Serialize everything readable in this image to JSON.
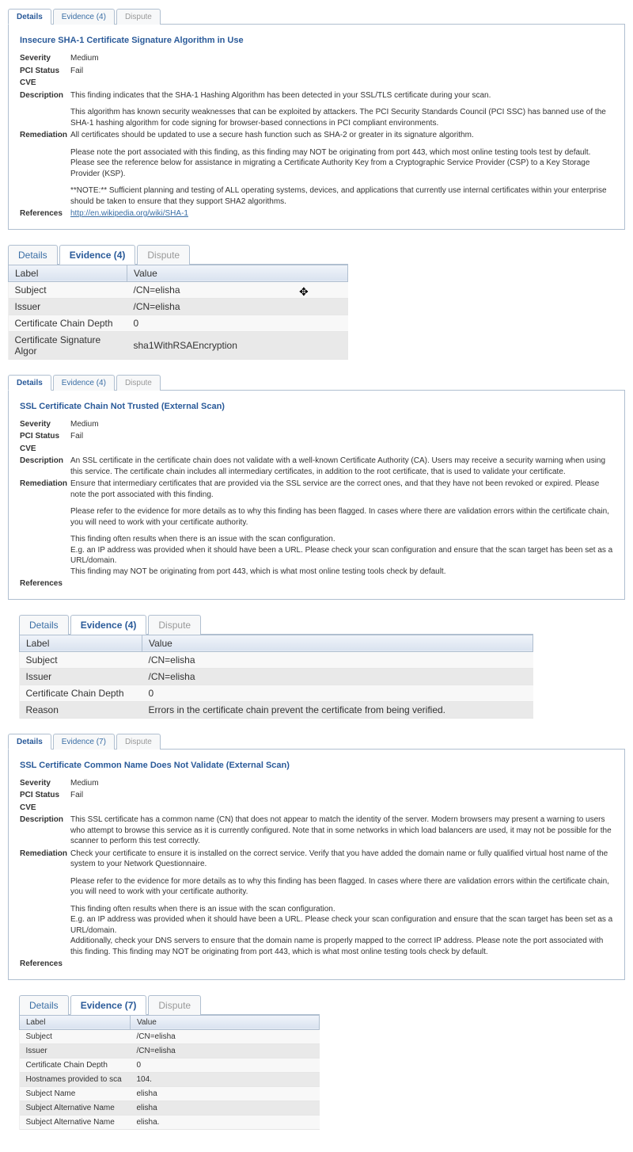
{
  "labels": {
    "details": "Details",
    "dispute": "Dispute",
    "severity": "Severity",
    "pci_status": "PCI Status",
    "cve": "CVE",
    "description": "Description",
    "remediation": "Remediation",
    "references": "References",
    "label_col": "Label",
    "value_col": "Value"
  },
  "finding1": {
    "evidence_tab": "Evidence (4)",
    "title": "Insecure SHA-1 Certificate Signature Algorithm in Use",
    "severity": "Medium",
    "pci_status": "Fail",
    "cve": "",
    "description_p1": "This finding indicates that the SHA-1 Hashing Algorithm has been detected in your SSL/TLS certificate during your scan.",
    "description_p2": "This algorithm has known security weaknesses that can be exploited by attackers. The PCI Security Standards Council (PCI SSC) has banned use of the SHA-1 hashing algorithm for code signing for browser-based connections in PCI compliant environments.",
    "remediation_p1": "All certificates should be updated to use a secure hash function such as SHA-2 or greater in its signature algorithm.",
    "remediation_p2": "Please note the port associated with this finding, as this finding may NOT be originating from port 443, which most online testing tools test by default. Please see the reference below for assistance in migrating a Certificate Authority Key from a Cryptographic Service Provider (CSP) to a Key Storage Provider (KSP).",
    "remediation_p3": "**NOTE:** Sufficient planning and testing of ALL operating systems, devices, and applications that currently use internal certificates within your enterprise should be taken to ensure that they support SHA2 algorithms.",
    "reference_link": "http://en.wikipedia.org/wiki/SHA-1"
  },
  "evidence1": {
    "evidence_tab": "Evidence (4)",
    "rows": {
      "r0": {
        "label": "Subject",
        "value": "/CN=elisha"
      },
      "r1": {
        "label": "Issuer",
        "value": "/CN=elisha"
      },
      "r2": {
        "label": "Certificate Chain Depth",
        "value": "0"
      },
      "r3": {
        "label": "Certificate Signature Algor",
        "value": "sha1WithRSAEncryption"
      }
    }
  },
  "finding2": {
    "evidence_tab": "Evidence (4)",
    "title": "SSL Certificate Chain Not Trusted (External Scan)",
    "severity": "Medium",
    "pci_status": "Fail",
    "cve": "",
    "description_p1": "An SSL certificate in the certificate chain does not validate with a well-known Certificate Authority (CA). Users may receive a security warning when using this service. The certificate chain includes all intermediary certificates, in addition to the root certificate, that is used to validate your certificate.",
    "remediation_p1": "Ensure that intermediary certificates that are provided via the SSL service are the correct ones, and that they have not been revoked or expired. Please note the port associated with this finding.",
    "remediation_p2": "Please refer to the evidence for more details as to why this finding has been flagged.  In cases where there are validation errors within the certificate chain, you will need to work with your certificate authority.",
    "remediation_p3": "This finding often results when there is an issue with the scan configuration.",
    "remediation_p4": "E.g. an IP address was provided when it should have been a URL. Please check your scan configuration and ensure that the scan target has been set as a URL/domain.",
    "remediation_p5": "This finding may NOT be originating from port 443, which is what most online testing tools check by default."
  },
  "evidence2": {
    "evidence_tab": "Evidence (4)",
    "rows": {
      "r0": {
        "label": "Subject",
        "value": "/CN=elisha"
      },
      "r1": {
        "label": "Issuer",
        "value": "/CN=elisha"
      },
      "r2": {
        "label": "Certificate Chain Depth",
        "value": "0"
      },
      "r3": {
        "label": "Reason",
        "value": "Errors in the certificate chain prevent the certificate from being verified."
      }
    }
  },
  "finding3": {
    "evidence_tab": "Evidence (7)",
    "title": "SSL Certificate Common Name Does Not Validate (External Scan)",
    "severity": "Medium",
    "pci_status": "Fail",
    "cve": "",
    "description_p1": "This SSL certificate has a common name (CN) that does not appear to match the identity of the server. Modern browsers may present a warning to users who attempt to browse this service as it is currently configured. Note that in some networks in which load balancers are used, it may not be possible for the scanner to perform this test correctly.",
    "remediation_p1": "Check your certificate to ensure it is installed on the correct service. Verify that you have added the domain name or fully qualified virtual host name of the system to your Network Questionnaire.",
    "remediation_p2": "Please refer to the evidence for more details as to why this finding has been flagged.  In cases where there are validation errors within the certificate chain, you will need to work with your certificate authority.",
    "remediation_p3": "This finding often results when there is an issue with the scan configuration.",
    "remediation_p4": "E.g. an IP address was provided when it should have been a URL. Please check your scan configuration and ensure that the scan target has been set as a URL/domain.",
    "remediation_p5": "Additionally, check your DNS servers to ensure that the domain name is properly mapped to the correct IP address. Please note the port associated with this finding. This finding may NOT be originating from port 443, which is what most online testing tools check by default."
  },
  "evidence3": {
    "evidence_tab": "Evidence (7)",
    "rows": {
      "r0": {
        "label": "Subject",
        "value": "/CN=elisha"
      },
      "r1": {
        "label": "Issuer",
        "value": "/CN=elisha"
      },
      "r2": {
        "label": "Certificate Chain Depth",
        "value": "0"
      },
      "r3": {
        "label": "Hostnames provided to sca",
        "value": "104."
      },
      "r4": {
        "label": "Subject Name",
        "value": "elisha"
      },
      "r5": {
        "label": "Subject Alternative Name",
        "value": "elisha"
      },
      "r6": {
        "label": "Subject Alternative Name",
        "value": "elisha."
      }
    }
  }
}
